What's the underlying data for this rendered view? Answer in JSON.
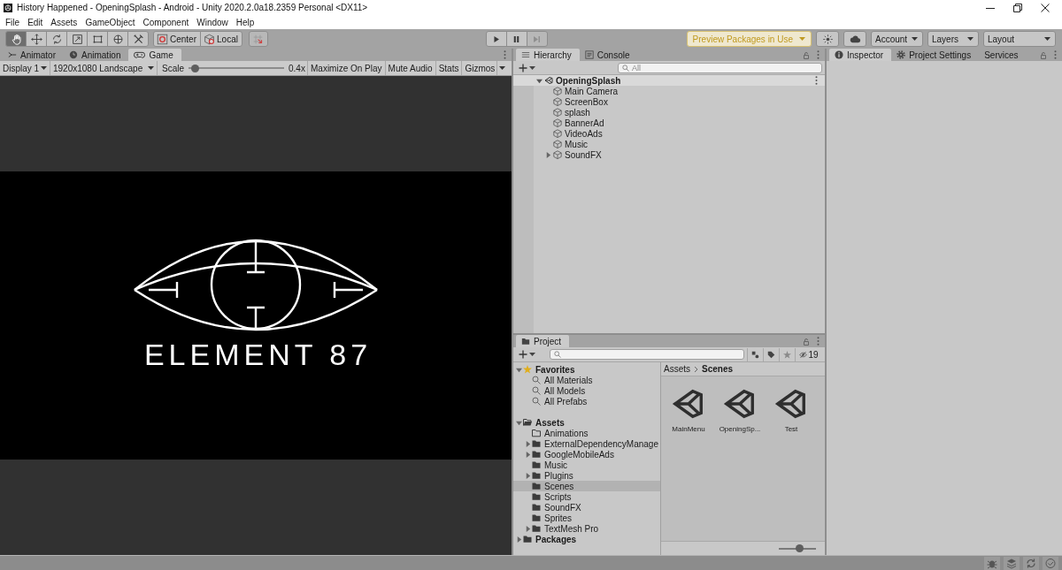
{
  "window": {
    "title": "History Happened - OpeningSplash - Android - Unity 2020.2.0a18.2359 Personal <DX11>"
  },
  "menu": [
    "File",
    "Edit",
    "Assets",
    "GameObject",
    "Component",
    "Window",
    "Help"
  ],
  "toolbar": {
    "tools": [
      {
        "kind": "hand",
        "selected": true
      },
      {
        "kind": "move",
        "selected": false
      },
      {
        "kind": "rotate",
        "selected": false
      },
      {
        "kind": "scale",
        "selected": false
      },
      {
        "kind": "rect",
        "selected": false
      },
      {
        "kind": "transform",
        "selected": false
      },
      {
        "kind": "custom",
        "selected": false
      }
    ],
    "pivot": [
      {
        "kind": "center",
        "label": "Center"
      },
      {
        "kind": "local",
        "label": "Local"
      }
    ],
    "playback": [
      {
        "kind": "play",
        "disabled": false
      },
      {
        "kind": "pause",
        "disabled": false
      },
      {
        "kind": "step",
        "disabled": true
      }
    ],
    "preview_packages": "Preview Packages in Use",
    "dropdowns": [
      "Account",
      "Layers",
      "Layout"
    ]
  },
  "game_panel": {
    "tabs": [
      {
        "label": "Animator",
        "kind": "animator",
        "selected": false
      },
      {
        "label": "Animation",
        "kind": "animation",
        "selected": false
      },
      {
        "label": "Game",
        "kind": "game",
        "selected": true
      }
    ],
    "display": "Display 1",
    "resolution": "1920x1080 Landscape",
    "scale": {
      "label": "Scale",
      "level": 0.03,
      "reading": "0.4x"
    },
    "toggles": [
      {
        "label": "Maximize On Play",
        "on": false
      },
      {
        "label": "Mute Audio",
        "on": false
      },
      {
        "label": "Stats",
        "on": false
      }
    ],
    "gizmos": "Gizmos",
    "logo_text": "ELEMENT 87"
  },
  "hierarchy": {
    "tabs": [
      {
        "label": "Hierarchy",
        "kind": "hierarchy",
        "selected": true
      },
      {
        "label": "Console",
        "kind": "console",
        "selected": false
      }
    ],
    "search": {
      "placeholder": "All"
    },
    "scene": {
      "name": "OpeningSplash",
      "expanded": true,
      "children": [
        {
          "name": "Main Camera",
          "has_children": false,
          "expanded": false
        },
        {
          "name": "ScreenBox",
          "has_children": false,
          "expanded": false
        },
        {
          "name": "splash",
          "has_children": false,
          "expanded": false
        },
        {
          "name": "BannerAd",
          "has_children": false,
          "expanded": false
        },
        {
          "name": "VideoAds",
          "has_children": false,
          "expanded": false
        },
        {
          "name": "Music",
          "has_children": false,
          "expanded": false
        },
        {
          "name": "SoundFX",
          "has_children": true,
          "expanded": false
        }
      ]
    }
  },
  "project": {
    "tabs": [
      {
        "label": "Project",
        "selected": true
      }
    ],
    "hidden_count": "19",
    "tree": [
      {
        "label": "Favorites",
        "kind": "favorites",
        "has_children": true,
        "expanded": true,
        "selected": false,
        "children": [
          {
            "label": "All Materials",
            "kind": "search",
            "has_children": false,
            "expanded": false,
            "selected": false
          },
          {
            "label": "All Models",
            "kind": "search",
            "has_children": false,
            "expanded": false,
            "selected": false
          },
          {
            "label": "All Prefabs",
            "kind": "search",
            "has_children": false,
            "expanded": false,
            "selected": false
          }
        ]
      },
      {
        "label": "Assets",
        "kind": "folder",
        "has_children": true,
        "expanded": true,
        "selected": false,
        "children": [
          {
            "label": "Animations",
            "kind": "empty_folder",
            "has_children": false,
            "expanded": false,
            "selected": false
          },
          {
            "label": "ExternalDependencyManage",
            "kind": "folder",
            "has_children": true,
            "expanded": false,
            "selected": false
          },
          {
            "label": "GoogleMobileAds",
            "kind": "folder",
            "has_children": true,
            "expanded": false,
            "selected": false
          },
          {
            "label": "Music",
            "kind": "folder",
            "has_children": false,
            "expanded": false,
            "selected": false
          },
          {
            "label": "Plugins",
            "kind": "folder",
            "has_children": true,
            "expanded": false,
            "selected": false
          },
          {
            "label": "Scenes",
            "kind": "folder",
            "has_children": false,
            "expanded": false,
            "selected": true
          },
          {
            "label": "Scripts",
            "kind": "folder",
            "has_children": false,
            "expanded": false,
            "selected": false
          },
          {
            "label": "SoundFX",
            "kind": "folder",
            "has_children": false,
            "expanded": false,
            "selected": false
          },
          {
            "label": "Sprites",
            "kind": "folder",
            "has_children": false,
            "expanded": false,
            "selected": false
          },
          {
            "label": "TextMesh Pro",
            "kind": "folder",
            "has_children": true,
            "expanded": false,
            "selected": false
          }
        ]
      },
      {
        "label": "Packages",
        "kind": "folder",
        "has_children": true,
        "expanded": false,
        "selected": false
      }
    ],
    "breadcrumb": [
      "Assets",
      "Scenes"
    ],
    "assets": [
      {
        "label": "MainMenu"
      },
      {
        "label": "OpeningSp..."
      },
      {
        "label": "Test"
      }
    ],
    "zoom": {
      "level": 0.58
    }
  },
  "inspector": {
    "tabs": [
      {
        "label": "Inspector",
        "kind": "info",
        "selected": true
      },
      {
        "label": "Project Settings",
        "kind": "settings",
        "selected": false
      },
      {
        "label": "Services",
        "kind": "plain",
        "selected": false
      }
    ]
  }
}
